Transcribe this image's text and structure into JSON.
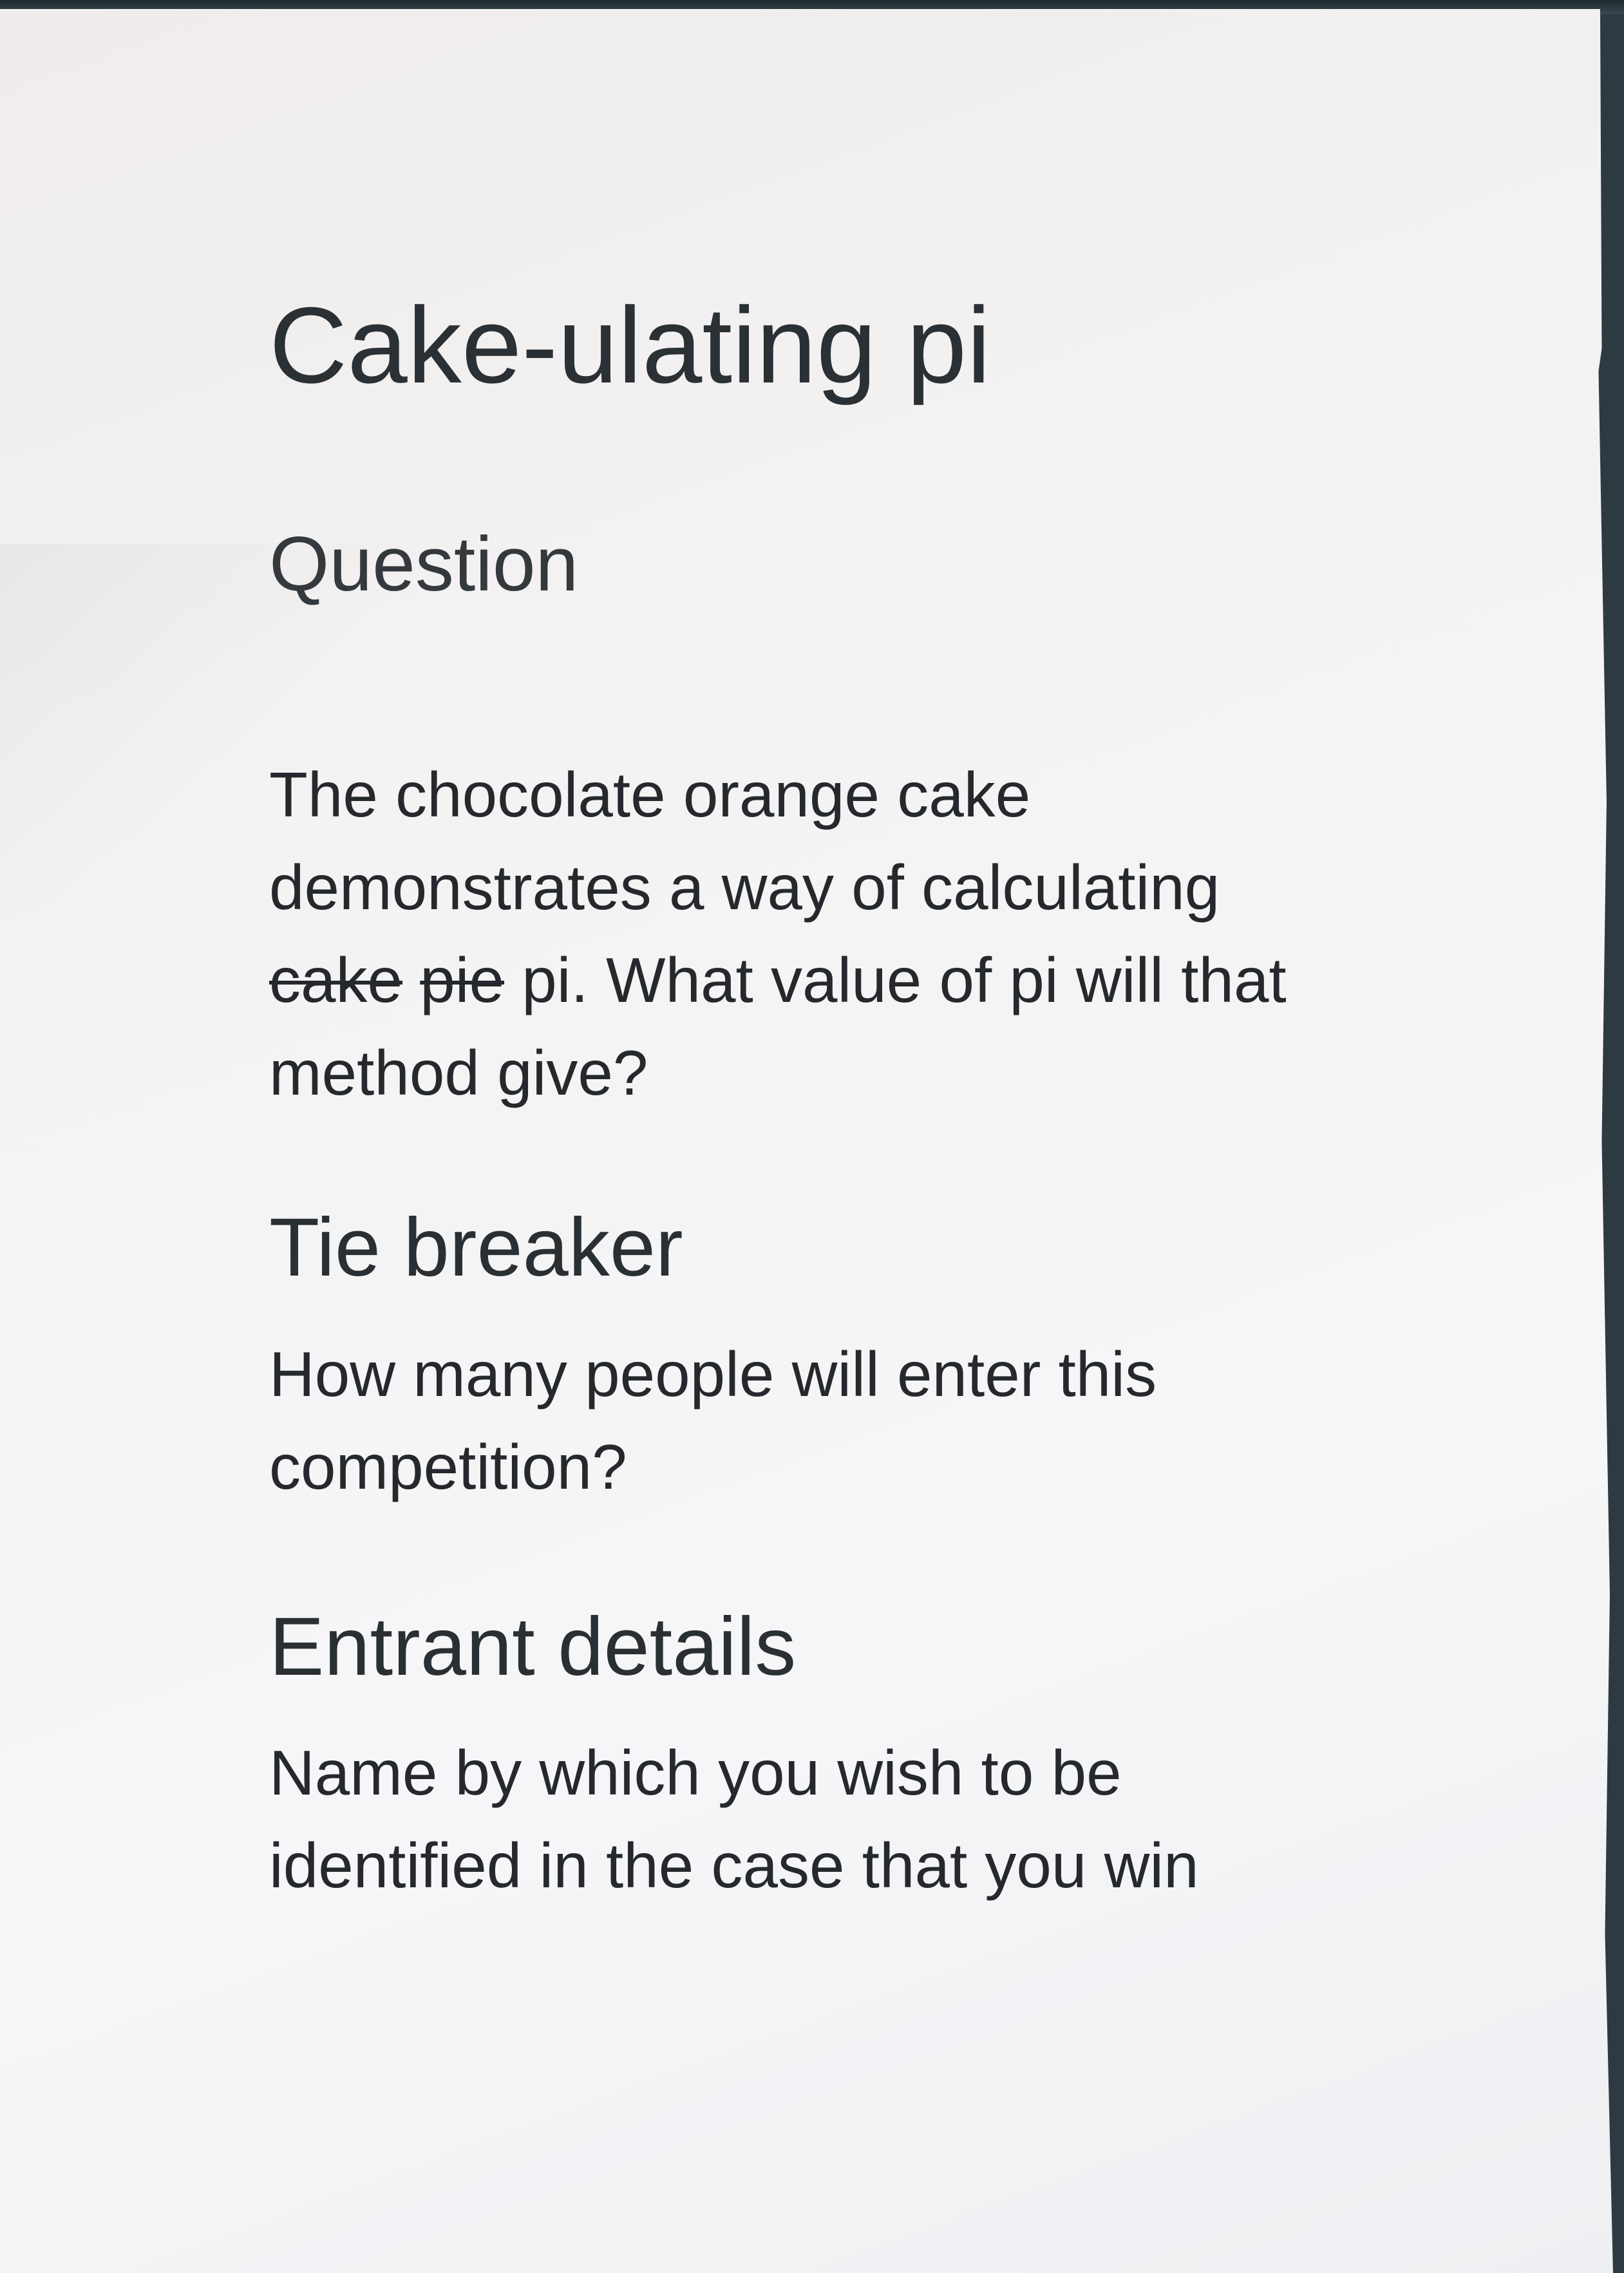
{
  "title": "Cake-ulating pi",
  "question": {
    "heading": "Question",
    "line1": "The chocolate orange cake",
    "line2": "demonstrates a way of calculating",
    "struck_word_1": "cake",
    "struck_word_2": "pie",
    "line3_rest": "pi.  What value of pi will that",
    "line4": "method give?"
  },
  "tie_breaker": {
    "heading": "Tie breaker",
    "line1": "How many people will enter this",
    "line2": "competition?"
  },
  "entrant_details": {
    "heading": "Entrant details",
    "line1": "Name by which you wish to be",
    "line2": "identified in the case that you win"
  }
}
